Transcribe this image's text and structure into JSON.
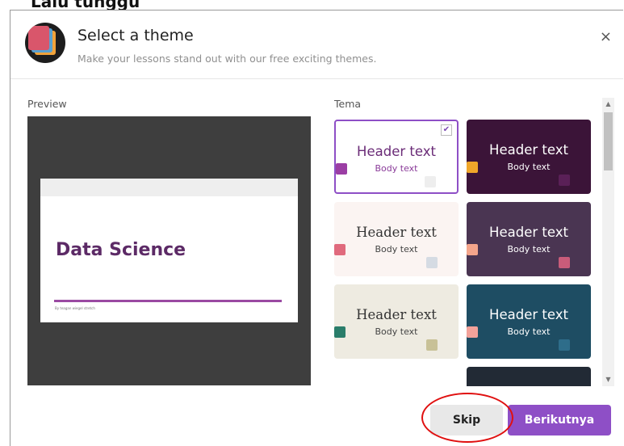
{
  "background_text": "Lalu tunggu",
  "dialog": {
    "title": "Select a theme",
    "subtitle": "Make your lessons stand out with our free exciting themes.",
    "close_icon": "×"
  },
  "preview": {
    "label": "Preview",
    "slide_title": "Data Science",
    "slide_footer": "By teagan wiegel stretch"
  },
  "themes": {
    "label": "Tema",
    "check": "✔",
    "cards": [
      {
        "header": "Header text",
        "body": "Body text",
        "bg": "#ffffff",
        "header_color": "#6a2b77",
        "body_color": "#8a3b99",
        "swatches": [
          "#eeeeee",
          "#9b3ea4"
        ],
        "selected": true
      },
      {
        "header": "Header text",
        "body": "Body text",
        "bg": "#3b1438",
        "header_color": "#ffffff",
        "body_color": "#ffffff",
        "swatches": [
          "#5a2057",
          "#f0a62a"
        ],
        "selected": false
      },
      {
        "header": "Header text",
        "body": "Body text",
        "bg": "#fbf4f2",
        "header_color": "#333333",
        "body_color": "#444444",
        "swatches": [
          "#d5dbe3",
          "#e06a7d"
        ],
        "selected": false
      },
      {
        "header": "Header text",
        "body": "Body text",
        "bg": "#4a3552",
        "header_color": "#ffffff",
        "body_color": "#ffffff",
        "swatches": [
          "#c95c7a",
          "#f4a58b"
        ],
        "selected": false
      },
      {
        "header": "Header text",
        "body": "Body text",
        "bg": "#eeebe1",
        "header_color": "#333333",
        "body_color": "#444444",
        "swatches": [
          "#c8c197",
          "#2a7d6a"
        ],
        "selected": false
      },
      {
        "header": "Header text",
        "body": "Body text",
        "bg": "#1e4d63",
        "header_color": "#ffffff",
        "body_color": "#ffffff",
        "swatches": [
          "#2e6d8a",
          "#f3a29a"
        ],
        "selected": false
      },
      {
        "header": "",
        "body": "",
        "bg": "#222a35",
        "header_color": "#ffffff",
        "body_color": "#ffffff",
        "swatches": [],
        "selected": false
      }
    ]
  },
  "buttons": {
    "skip": "Skip",
    "next": "Berikutnya"
  },
  "colors": {
    "accent": "#8e4fc6",
    "annotation_circle": "#e01010"
  }
}
